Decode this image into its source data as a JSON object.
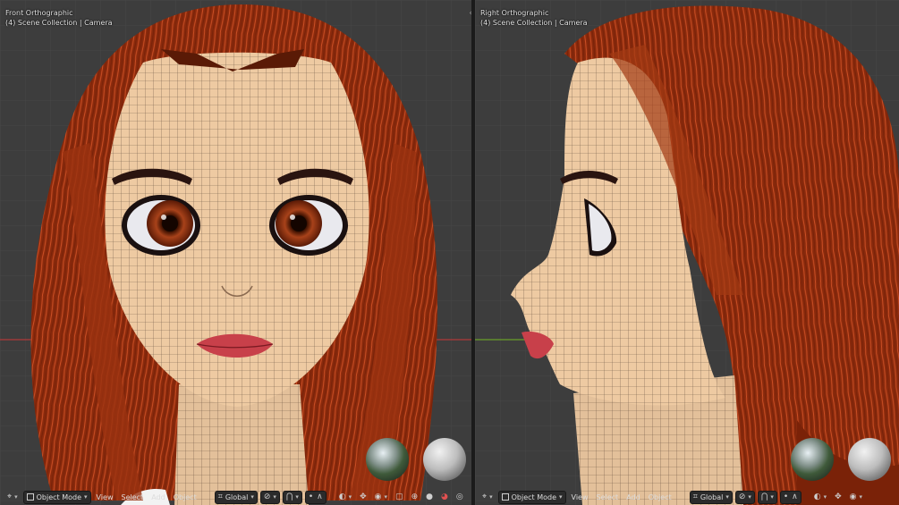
{
  "front_view": {
    "title": "Front Orthographic",
    "collection": "(4) Scene Collection | Camera"
  },
  "right_view": {
    "title": "Right Orthographic",
    "collection": "(4) Scene Collection | Camera"
  },
  "header": {
    "mode": "Object Mode",
    "menu_view": "View",
    "menu_select": "Select",
    "menu_add": "Add",
    "menu_object": "Object",
    "orientation": "Global"
  },
  "colors": {
    "viewport_bg": "#3d3d3d",
    "hair": "#a83a14",
    "skin": "#e8c59e",
    "lips": "#c8404a",
    "x_axis": "#b13a3a",
    "y_axis": "#6aa02a"
  },
  "icons": [
    "editor-type-icon",
    "object-mode-icon",
    "transform-orientation-icon",
    "pivot-icon",
    "snap-icon",
    "proportional-icon",
    "overlay-icon",
    "gizmo-icon",
    "shading-wireframe-icon",
    "shading-solid-icon",
    "shading-material-icon",
    "shading-rendered-icon",
    "hdri-preview-icon",
    "matcap-preview-icon"
  ]
}
